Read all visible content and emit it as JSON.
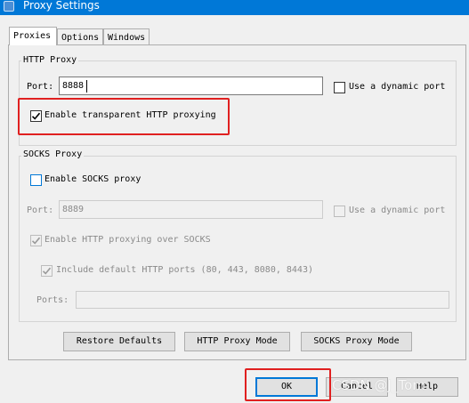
{
  "window": {
    "title": "Proxy Settings"
  },
  "tabs": [
    {
      "label": "Proxies",
      "active": true
    },
    {
      "label": "Options",
      "active": false
    },
    {
      "label": "Windows",
      "active": false
    }
  ],
  "http_proxy": {
    "group_title": "HTTP Proxy",
    "port_label": "Port:",
    "port_value": "8888",
    "dynamic_port_label": "Use a dynamic port",
    "dynamic_port_checked": false,
    "transparent_label": "Enable transparent HTTP proxying",
    "transparent_checked": true
  },
  "socks_proxy": {
    "group_title": "SOCKS Proxy",
    "enable_label": "Enable SOCKS proxy",
    "enable_checked": false,
    "port_label": "Port:",
    "port_value": "8889",
    "dynamic_port_label": "Use a dynamic port",
    "http_over_socks_label": "Enable HTTP proxying over SOCKS",
    "include_ports_label": "Include default HTTP ports (80, 443, 8080, 8443)",
    "ports_label": "Ports:",
    "ports_value": ""
  },
  "buttons": {
    "restore_defaults": "Restore Defaults",
    "http_proxy_mode": "HTTP Proxy Mode",
    "socks_proxy_mode": "SOCKS Proxy Mode",
    "ok": "OK",
    "cancel": "Cancel",
    "help": "Help"
  },
  "watermark": "CSDN @J_Tom",
  "colors": {
    "titlebar": "#0078d7",
    "highlight": "#e02020",
    "focus_blue": "#0078d7"
  }
}
